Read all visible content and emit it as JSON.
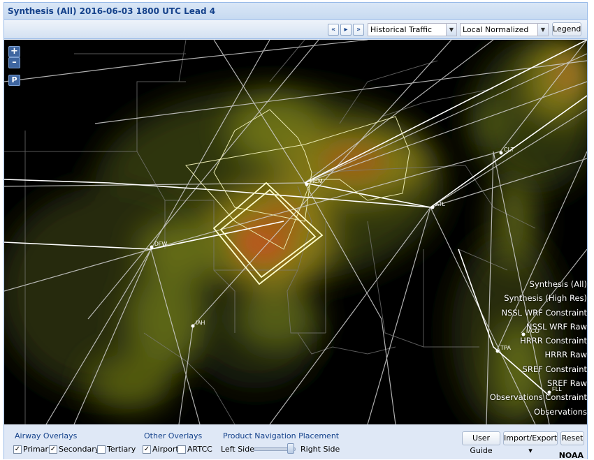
{
  "window": {
    "title": "Synthesis (All) 2016-06-03 1800 UTC Lead 4"
  },
  "toolbar": {
    "first_icon": "«",
    "next_icon": "▸",
    "last_icon": "»",
    "traffic_select": "Historical Traffic",
    "normalize_select": "Local Normalized",
    "legend_label": "Legend"
  },
  "map": {
    "zoom_in": "+",
    "zoom_out": "–",
    "pan_label": "P",
    "airports": [
      "MEM",
      "ATL",
      "CLT",
      "DFW",
      "IAH",
      "TPA",
      "MCO",
      "FLL"
    ],
    "products": [
      "Synthesis (All)",
      "Synthesis (High Res)",
      "NSSL WRF Constraint",
      "NSSL WRF Raw",
      "HRRR Constraint",
      "HRRR Raw",
      "SREF Constraint",
      "SREF Raw",
      "Observations Constraint",
      "Observations"
    ]
  },
  "bottom": {
    "airway_title": "Airway Overlays",
    "primary": "Primary",
    "secondary": "Secondary",
    "tertiary": "Tertiary",
    "other_title": "Other Overlays",
    "airport": "Airport",
    "artcc": "ARTCC",
    "placement_title": "Product Navigation Placement",
    "left_side": "Left Side",
    "right_side": "Right Side",
    "check_mark": "✓",
    "user_guide": "User Guide",
    "import_export": "Import/Export ▾",
    "reset": "Reset",
    "credit": "NOAA"
  }
}
